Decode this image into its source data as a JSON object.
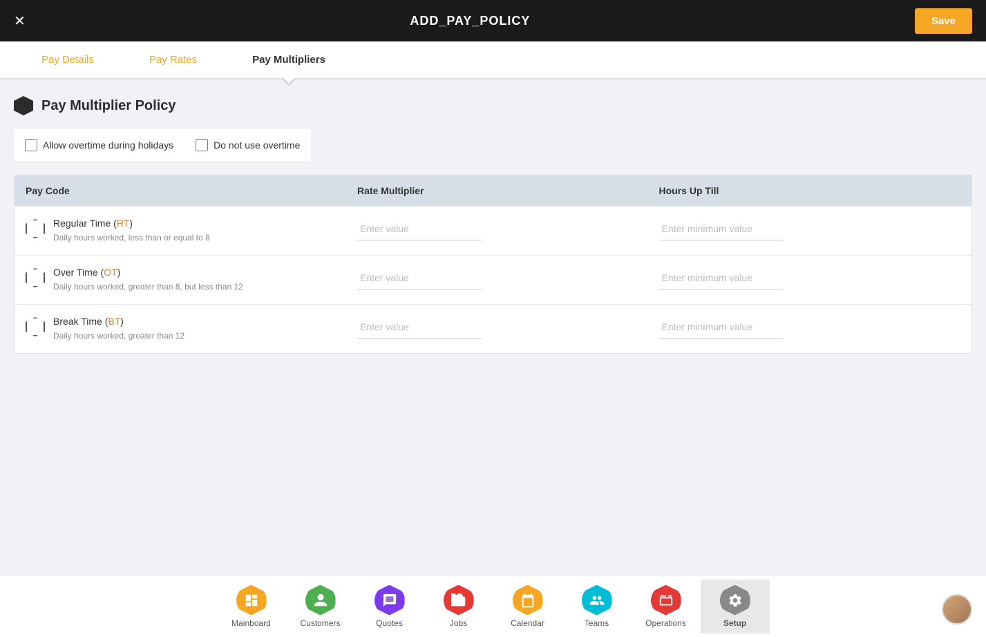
{
  "header": {
    "title": "ADD_PAY_POLICY",
    "save_label": "Save",
    "close_icon": "×"
  },
  "tabs": [
    {
      "id": "pay-details",
      "label": "Pay Details",
      "active": false
    },
    {
      "id": "pay-rates",
      "label": "Pay Rates",
      "active": false
    },
    {
      "id": "pay-multipliers",
      "label": "Pay Multipliers",
      "active": true
    }
  ],
  "section": {
    "title": "Pay Multiplier Policy"
  },
  "checkboxes": [
    {
      "id": "allow-overtime",
      "label": "Allow overtime during holidays",
      "checked": false
    },
    {
      "id": "no-overtime",
      "label": "Do not use overtime",
      "checked": false
    }
  ],
  "table": {
    "headers": [
      "Pay Code",
      "Rate Multiplier",
      "Hours Up Till"
    ],
    "rows": [
      {
        "name": "Regular Time (RT)",
        "name_plain": "Regular Time ",
        "code": "RT",
        "description": "Daily hours worked, less than or equal to 8",
        "rate_placeholder": "Enter value",
        "hours_placeholder": "Enter minimum value"
      },
      {
        "name": "Over Time (OT)",
        "name_plain": "Over Time ",
        "code": "OT",
        "description": "Daily hours worked, greater than 8, but less than 12",
        "rate_placeholder": "Enter value",
        "hours_placeholder": "Enter minimum value"
      },
      {
        "name": "Break Time (BT)",
        "name_plain": "Break Time ",
        "code": "BT",
        "description": "Daily hours worked, greater than 12",
        "rate_placeholder": "Enter value",
        "hours_placeholder": "Enter minimum value"
      }
    ]
  },
  "bottom_nav": [
    {
      "id": "mainboard",
      "label": "Mainboard",
      "color": "#f5a623",
      "active": false
    },
    {
      "id": "customers",
      "label": "Customers",
      "color": "#4caf50",
      "active": false
    },
    {
      "id": "quotes",
      "label": "Quotes",
      "color": "#7c3aed",
      "active": false
    },
    {
      "id": "jobs",
      "label": "Jobs",
      "color": "#e53935",
      "active": false
    },
    {
      "id": "calendar",
      "label": "Calendar",
      "color": "#f5a623",
      "active": false
    },
    {
      "id": "teams",
      "label": "Teams",
      "color": "#00bcd4",
      "active": false
    },
    {
      "id": "operations",
      "label": "Operations",
      "color": "#e53935",
      "active": false
    },
    {
      "id": "setup",
      "label": "Setup",
      "color": "#888",
      "active": true
    }
  ]
}
